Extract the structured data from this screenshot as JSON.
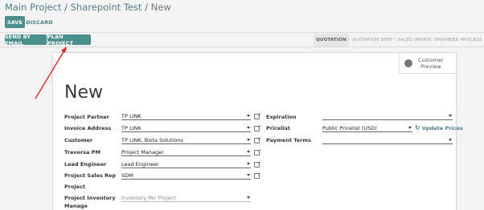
{
  "breadcrumb": {
    "items": [
      "Main Project",
      "Sharepoint Test"
    ],
    "separator": "/",
    "current": "New"
  },
  "toolbar": {
    "save_label": "SAVE",
    "discard_label": "DISCARD"
  },
  "actions": {
    "send_email_label": "SEND BY EMAIL",
    "plan_project_label": "PLAN PROJECT"
  },
  "status": {
    "stages": [
      "QUOTATION",
      "QUOTATION SENT",
      "SALES ORDER",
      "ENGINEER PROCESS"
    ],
    "active": "QUOTATION"
  },
  "preview": {
    "line1": "Customer",
    "line2": "Preview",
    "icon": "globe-icon"
  },
  "form": {
    "title": "New",
    "left": [
      {
        "label": "Project Partner",
        "value": "TP LINK"
      },
      {
        "label": "Invoice Address",
        "value": "TP LINK"
      },
      {
        "label": "Customer",
        "value": "TP LINK, Bista Solutions"
      },
      {
        "label": "Traversa PM",
        "value": "Project Manager"
      },
      {
        "label": "Lead Engineer",
        "value": "Lead Engineer"
      },
      {
        "label": "Project Sales Rep",
        "value": "SDM"
      },
      {
        "label": "Project",
        "value": ""
      },
      {
        "label": "Project Inventory",
        "label2": "Manage",
        "value": "Inventory Per Project"
      }
    ],
    "right": [
      {
        "label": "Expiration",
        "value": ""
      },
      {
        "label": "Pricelist",
        "value": "Public Pricelist (USD)"
      },
      {
        "label": "Payment Terms",
        "value": ""
      }
    ],
    "update_prices_label": "Update Prices"
  },
  "colors": {
    "primary": "#4a8f8c",
    "link": "#4f7f86",
    "annotation_arrow": "#e02020"
  }
}
